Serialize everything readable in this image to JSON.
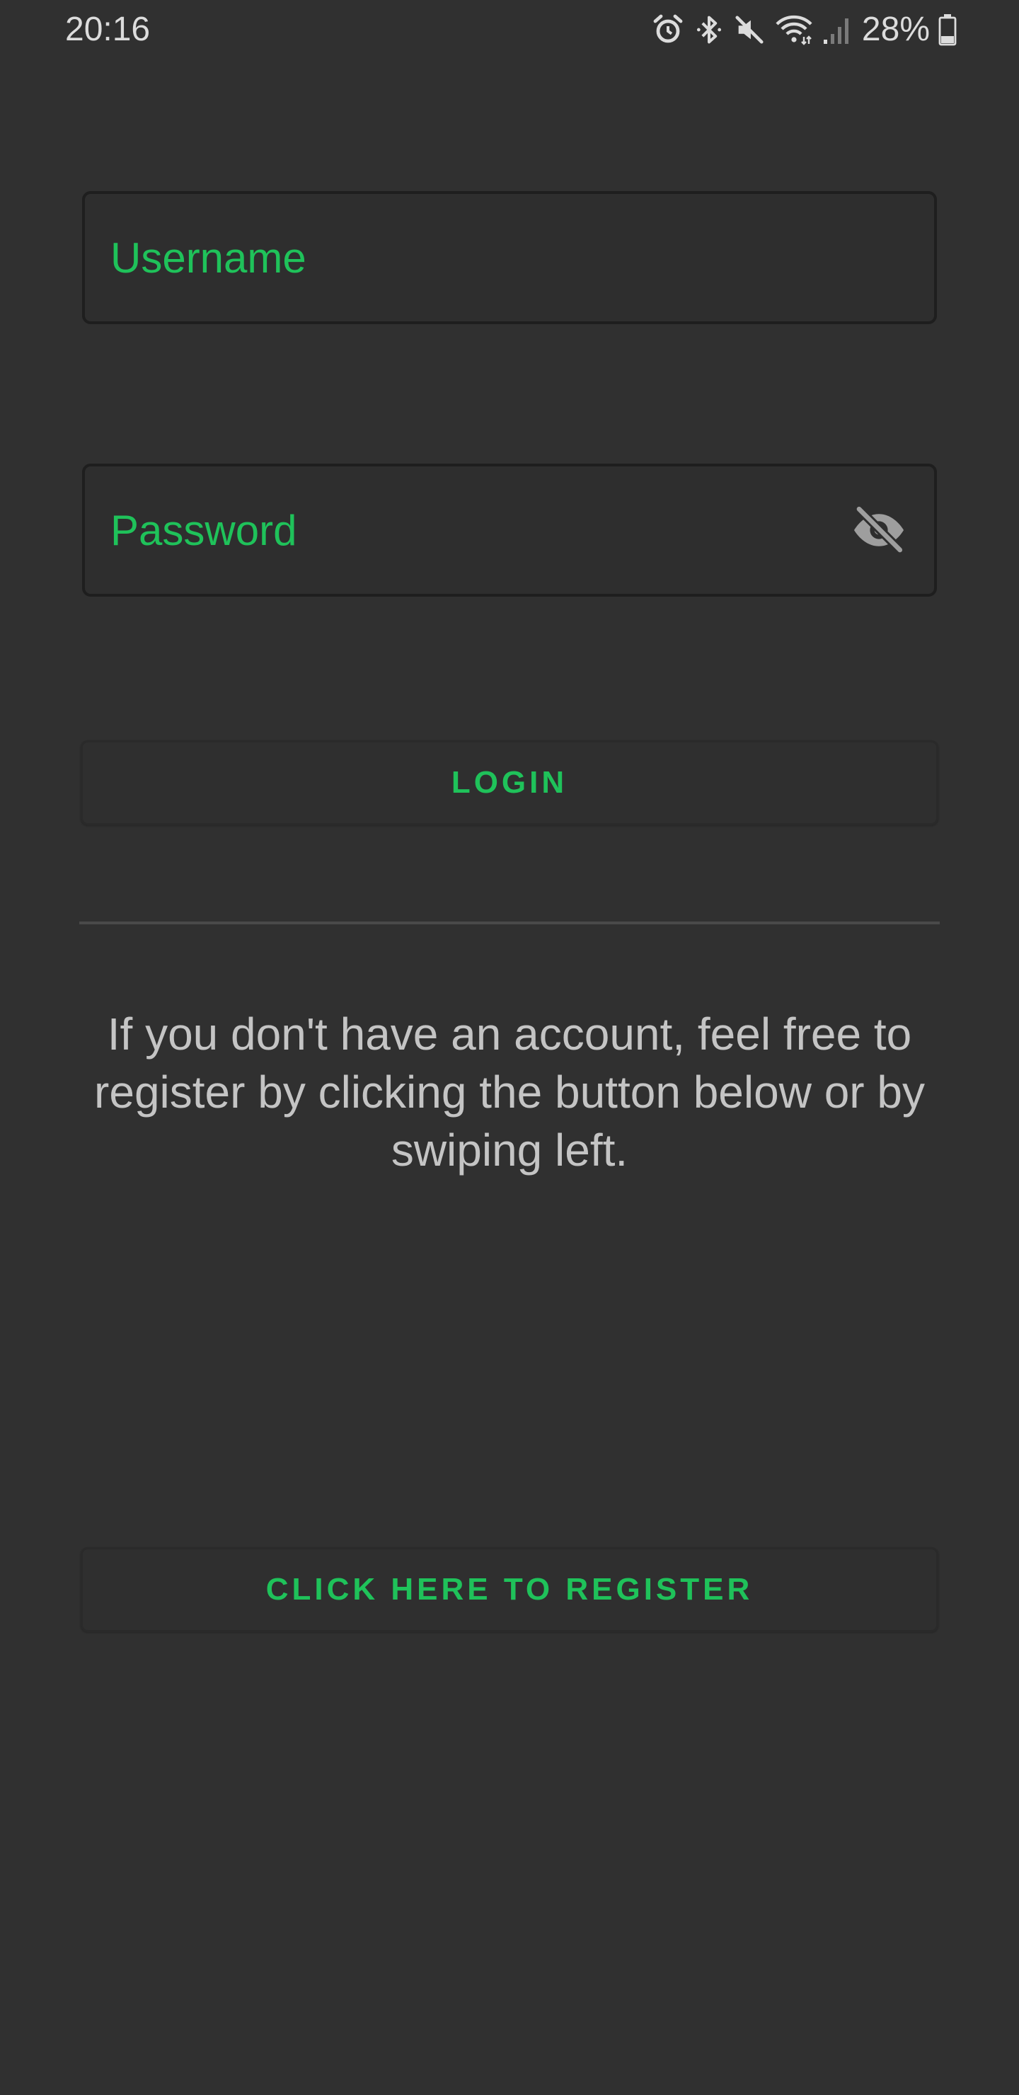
{
  "status_bar": {
    "time": "20:16",
    "battery_percent": "28%",
    "icons": [
      "alarm-icon",
      "bluetooth-icon",
      "mute-icon",
      "wifi-icon",
      "signal-icon",
      "battery-icon"
    ]
  },
  "form": {
    "username": {
      "placeholder": "Username",
      "value": ""
    },
    "password": {
      "placeholder": "Password",
      "value": "",
      "toggle_icon": "eye-off-icon"
    },
    "login_label": "LOGIN"
  },
  "info_text": "If you don't have an account, feel free to register by clicking the button below or by swiping left.",
  "register_label": "CLICK HERE TO REGISTER",
  "colors": {
    "background": "#303030",
    "accent": "#1fc25a",
    "text_muted": "#c4c4c4"
  }
}
